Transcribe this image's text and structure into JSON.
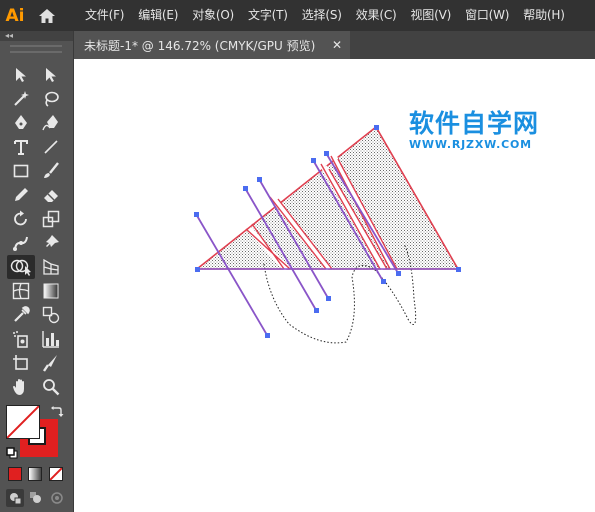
{
  "app": {
    "logo_text": "Ai"
  },
  "menu": {
    "items": [
      "文件(F)",
      "编辑(E)",
      "对象(O)",
      "文字(T)",
      "选择(S)",
      "效果(C)",
      "视图(V)",
      "窗口(W)",
      "帮助(H)"
    ]
  },
  "document": {
    "tab_title": "未标题-1* @ 146.72% (CMYK/GPU 预览)",
    "close_glyph": "✕"
  },
  "panel": {
    "collapse_glyph": "◂◂"
  },
  "watermark": {
    "title": "软件自学网",
    "url": "WWW.RJZXW.COM"
  },
  "colors": {
    "fill": "#ffffff",
    "stroke": "#e02020",
    "path_stroke": "#e04050",
    "selection": "#4b6cf0",
    "line": "#8a55c8",
    "brand_blue": "#1a8fe0",
    "logo_orange": "#ff9a00"
  }
}
